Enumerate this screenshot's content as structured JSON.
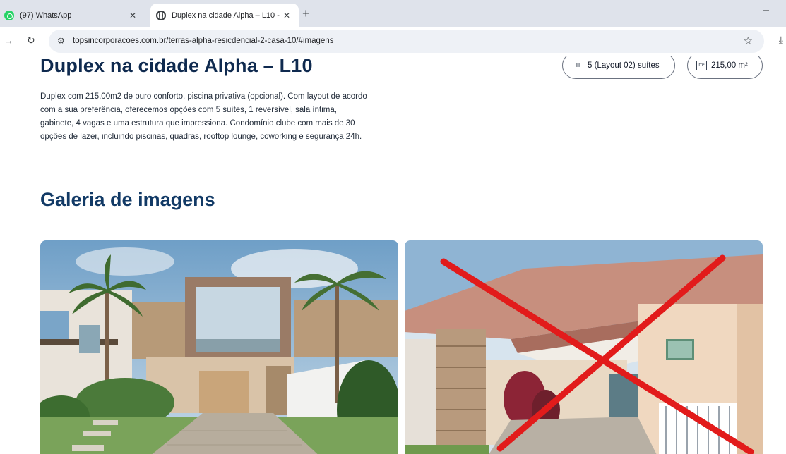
{
  "browser": {
    "tabs": [
      {
        "title": "(97) WhatsApp",
        "icon": "whatsapp-icon",
        "active": false
      },
      {
        "title": "Duplex na cidade Alpha – L10 -",
        "icon": "globe-icon",
        "active": true
      }
    ],
    "address": "topsincorporacoes.com.br/terras-alpha-resicdencial-2-casa-10/#imagens"
  },
  "property": {
    "title": "Duplex na cidade Alpha – L10",
    "badges": [
      {
        "icon": "suite-icon",
        "label": "5 (Layout 02) suítes"
      },
      {
        "icon": "area-icon",
        "label": "215,00 m²"
      }
    ],
    "description": "Duplex com 215,00m2 de puro conforto, piscina privativa (opcional). Com layout de acordo com a sua preferência, oferecemos opções com 5 suítes, 1 reversível, sala íntima, gabinete, 4 vagas e uma estrutura que impressiona. Condomínio clube com mais de 30 opções de lazer, incluindo piscinas, quadras, rooftop lounge, coworking e segurança 24h."
  },
  "gallery": {
    "title": "Galeria de imagens",
    "images": [
      {
        "subject": "duplex-facade-with-palm-trees"
      },
      {
        "subject": "duplex-garage-crossed-out",
        "overlay": "red-x",
        "overlay_color": "#e21b1b"
      }
    ]
  },
  "colors": {
    "title": "#0f2a4f",
    "section_title": "#123a66",
    "cross": "#e21b1b"
  }
}
